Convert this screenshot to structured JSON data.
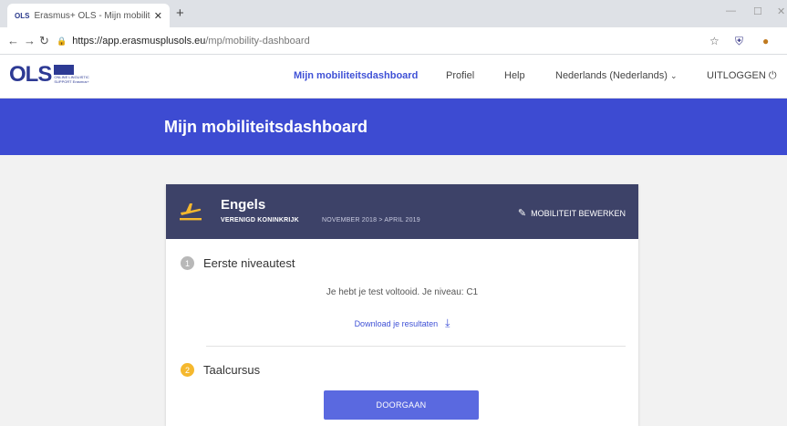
{
  "browser": {
    "tab_icon_text": "OLS",
    "tab_title": "Erasmus+ OLS - Mijn mobiliteits",
    "tab_close": "✕",
    "new_tab": "+",
    "url_host": "https://app.erasmusplusols.eu",
    "url_path": "/mp/mobility-dashboard"
  },
  "header": {
    "logo_text": "OLS",
    "logo_tagline_1": "ONLINE LINGUISTIC",
    "logo_tagline_2": "SUPPORT Erasmus+",
    "nav": {
      "dashboard": "Mijn mobiliteitsdashboard",
      "profile": "Profiel",
      "help": "Help",
      "language": "Nederlands (Nederlands)",
      "logout": "UITLOGGEN"
    }
  },
  "hero": {
    "title": "Mijn mobiliteitsdashboard"
  },
  "mobility": {
    "language": "Engels",
    "country": "VERENIGD KONINKRIJK",
    "period": "NOVEMBER 2018 > APRIL 2019",
    "edit_label": "MOBILITEIT BEWERKEN"
  },
  "steps": [
    {
      "number": "1",
      "label": "Eerste niveautest",
      "result": "Je hebt je test voltooid. Je niveau: C1",
      "download": "Download je resultaten",
      "color": "#b8b8b8"
    },
    {
      "number": "2",
      "label": "Taalcursus",
      "button": "DOORGAAN",
      "color": "#f5b82e"
    }
  ],
  "colors": {
    "brand_blue": "#3d4bd2",
    "card_header": "#3d4268",
    "accent": "#3f51d6"
  }
}
